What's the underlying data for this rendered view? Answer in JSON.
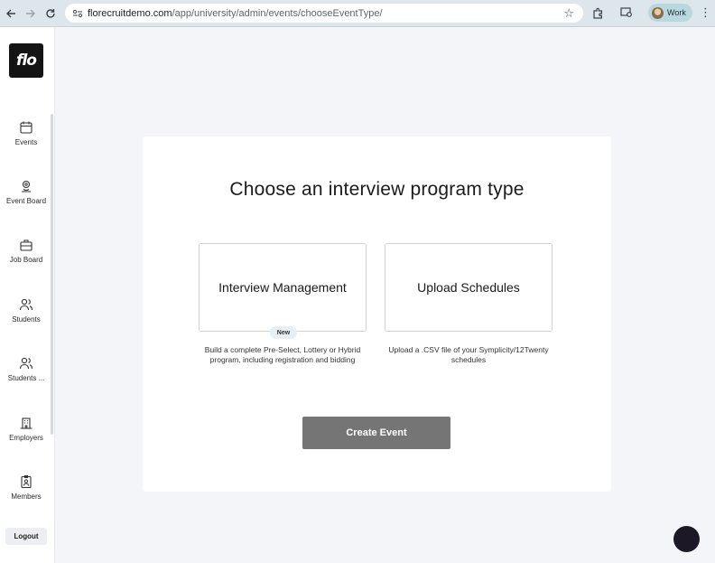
{
  "browser": {
    "url_host": "florecruitdemo.com",
    "url_path": "/app/university/admin/events/chooseEventType/",
    "profile_label": "Work"
  },
  "sidebar": {
    "logo": "flo",
    "items": [
      {
        "label": "Events",
        "icon": "calendar-icon"
      },
      {
        "label": "Event Board",
        "icon": "location-pin-icon"
      },
      {
        "label": "Job Board",
        "icon": "briefcase-icon"
      },
      {
        "label": "Students",
        "icon": "users-icon"
      },
      {
        "label": "Students ...",
        "icon": "users-icon"
      },
      {
        "label": "Employers",
        "icon": "building-icon"
      },
      {
        "label": "Members",
        "icon": "id-badge-icon"
      }
    ],
    "logout_label": "Logout"
  },
  "main": {
    "heading": "Choose an interview program type",
    "options": [
      {
        "title": "Interview Management",
        "badge": "New",
        "description": "Build a complete Pre-Select, Lottery or Hybrid program, including registration and bidding"
      },
      {
        "title": "Upload Schedules",
        "description": "Upload a .CSV file of your Symplicity/12Twenty schedules"
      }
    ],
    "create_button": "Create Event"
  }
}
